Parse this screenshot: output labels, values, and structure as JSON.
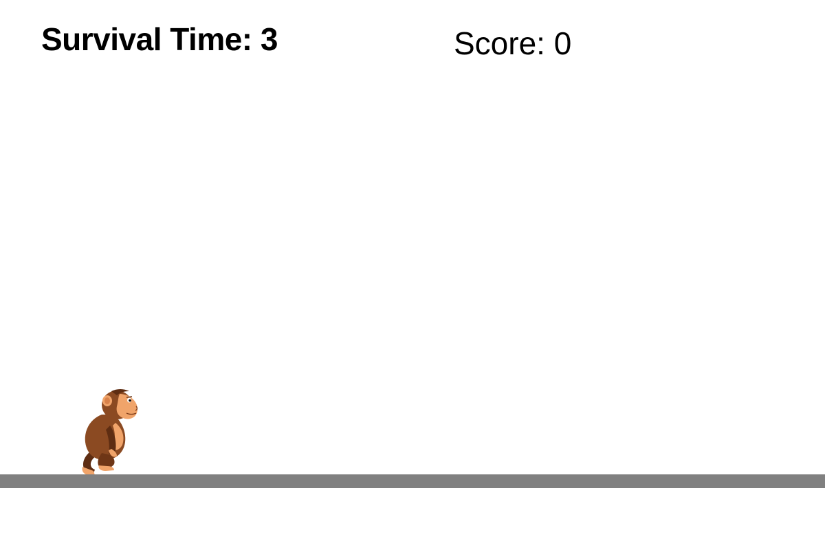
{
  "hud": {
    "survival_label": "Survival Time: ",
    "survival_value": "3",
    "score_label": "Score: ",
    "score_value": "0"
  },
  "colors": {
    "background": "#ffffff",
    "ground": "#808080",
    "monkey_fur": "#8b4a22",
    "monkey_fur_dark": "#5e2d12",
    "monkey_skin": "#f0a46a"
  },
  "player": {
    "sprite": "monkey-running-icon"
  }
}
